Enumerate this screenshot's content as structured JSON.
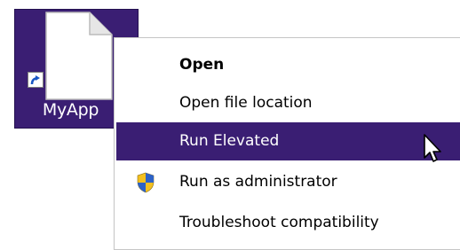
{
  "desktop_icon": {
    "label": "MyApp"
  },
  "context_menu": {
    "items": [
      {
        "label": "Open",
        "bold": true,
        "highlighted": false
      },
      {
        "label": "Open file location",
        "bold": false,
        "highlighted": false
      },
      {
        "label": "Run Elevated",
        "bold": false,
        "highlighted": true
      },
      {
        "label": "Run as administrator",
        "bold": false,
        "highlighted": false,
        "icon": "uac-shield-icon"
      },
      {
        "label": "Troubleshoot compatibility",
        "bold": false,
        "highlighted": false
      }
    ]
  },
  "colors": {
    "selection": "#3a1e73",
    "menu_background": "#ffffff",
    "text": "#000000"
  }
}
